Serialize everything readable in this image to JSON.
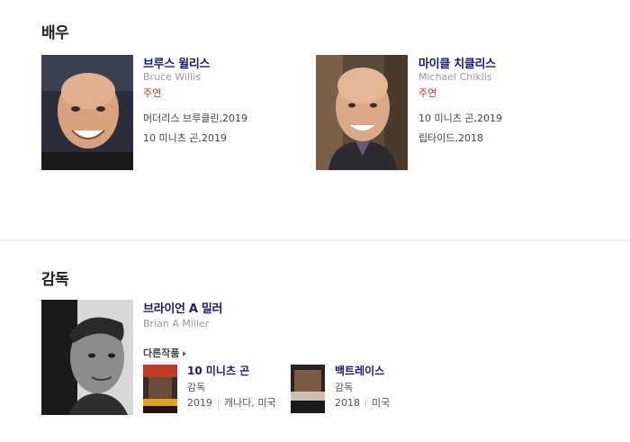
{
  "actors_section": {
    "title": "배우"
  },
  "actors": [
    {
      "name_ko": "브루스 윌리스",
      "name_en": "Bruce Willis",
      "role": "주연",
      "works": [
        "머더리스 브루클린,2019",
        "10 미니츠 곤,2019"
      ]
    },
    {
      "name_ko": "마이클 치클리스",
      "name_en": "Michael Chiklis",
      "role": "주연",
      "works": [
        "10 미니츠 곤,2019",
        "립타이드,2018"
      ]
    }
  ],
  "director_section": {
    "title": "감독"
  },
  "director": {
    "name_ko": "브라이언 A 밀러",
    "name_en": "Brian A Miller",
    "other_works_label": "다른작품",
    "movies": [
      {
        "title": "10 미니츠 곤",
        "role": "감독",
        "year": "2019",
        "country": "캐나다, 미국"
      },
      {
        "title": "백트레이스",
        "role": "감독",
        "year": "2018",
        "country": "미국"
      }
    ]
  }
}
